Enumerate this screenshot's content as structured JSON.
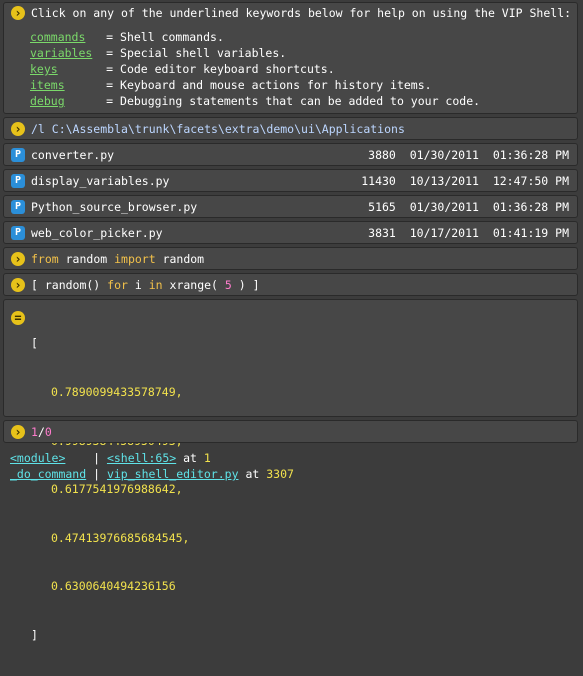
{
  "help": {
    "intro": "Click on any of the underlined keywords below for help on using the VIP Shell:",
    "items": [
      {
        "keyword": "commands",
        "pad": "  ",
        "desc": " = Shell commands."
      },
      {
        "keyword": "variables",
        "pad": " ",
        "desc": " = Special shell variables."
      },
      {
        "keyword": "keys",
        "pad": "      ",
        "desc": " = Code editor keyboard shortcuts."
      },
      {
        "keyword": "items",
        "pad": "     ",
        "desc": " = Keyboard and mouse actions for history items."
      },
      {
        "keyword": "debug",
        "pad": "     ",
        "desc": " = Debugging statements that can be added to your code."
      }
    ]
  },
  "path_command": "/l C:\\Assembla\\trunk\\facets\\extra\\demo\\ui\\Applications",
  "files": [
    {
      "name": "converter.py",
      "size": "3880",
      "date": "01/30/2011",
      "time": "01:36:28 PM"
    },
    {
      "name": "display_variables.py",
      "size": "11430",
      "date": "10/13/2011",
      "time": "12:47:50 PM"
    },
    {
      "name": "Python_source_browser.py",
      "size": "5165",
      "date": "01/30/2011",
      "time": "01:36:28 PM"
    },
    {
      "name": "web_color_picker.py",
      "size": "3831",
      "date": "10/17/2011",
      "time": "01:41:19 PM"
    }
  ],
  "cmd_import": {
    "from": "from",
    "module": " random ",
    "import": "import",
    "name": " random"
  },
  "cmd_listcomp": {
    "open": "[ random() ",
    "for": "for",
    "var": " i ",
    "in": "in",
    "call": " xrange( ",
    "arg": "5",
    "close": " ) ]"
  },
  "result": {
    "open": "[",
    "values": [
      "0.7890099433578749,",
      "0.9989384458950493,",
      "0.6177541976988642,",
      "0.47413976685684545,",
      "0.6300640494236156"
    ],
    "close": "]"
  },
  "error_cmd": {
    "left": "1",
    "op": "/",
    "right": "0"
  },
  "traceback": [
    {
      "func": "<module>",
      "sep": "    | ",
      "loc": "<shell:65>",
      "at": " at ",
      "line": "1"
    },
    {
      "func": "_do_command",
      "sep": " | ",
      "loc": "vip_shell_editor.py",
      "at": " at ",
      "line": "3307"
    }
  ],
  "colors": {
    "background": "#3c3c3c",
    "panel": "#474747",
    "keyword_green": "#7bd96a",
    "number_yellow": "#f2e24d",
    "keyword_gold": "#f2c14a",
    "keyword_pink": "#ff7ccd",
    "link_cyan": "#5fe3e8",
    "icon_gold": "#e7c21a",
    "icon_blue": "#2b8fd9"
  },
  "icons": {
    "command": "chevron-right-icon",
    "file": "python-file-icon",
    "result": "equals-icon"
  }
}
